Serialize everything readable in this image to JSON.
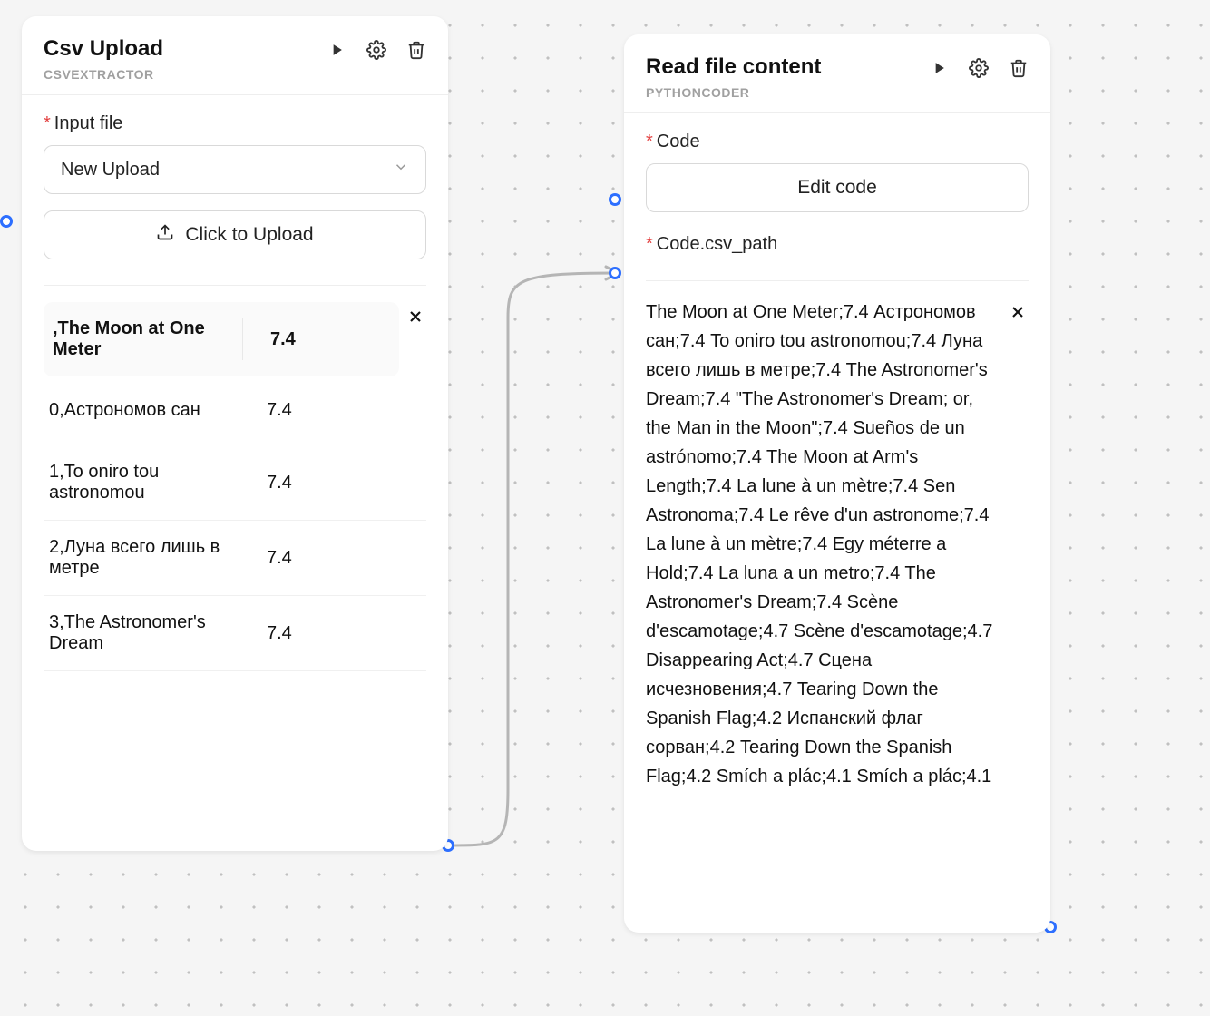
{
  "nodes": {
    "left": {
      "title": "Csv Upload",
      "subtitle": "CSVEXTRACTOR",
      "input_label": "Input file",
      "select_value": "New Upload",
      "upload_button": "Click to Upload",
      "header_col1": ",The Moon at One Meter",
      "header_col2": "7.4",
      "rows": [
        {
          "c1": "0,Астрономов сан",
          "c2": "7.4"
        },
        {
          "c1": "1,To oniro tou astronomou",
          "c2": "7.4"
        },
        {
          "c1": "2,Луна всего лишь в метре",
          "c2": "7.4"
        },
        {
          "c1": "3,The Astronomer's Dream",
          "c2": "7.4"
        }
      ]
    },
    "right": {
      "title": "Read file content",
      "subtitle": "PYTHONCODER",
      "code_label": "Code",
      "edit_button": "Edit code",
      "path_label": "Code.csv_path",
      "output": "The Moon at One Meter;7.4 Астрономов сан;7.4 To oniro tou astronomou;7.4 Луна всего лишь в метре;7.4 The Astronomer's Dream;7.4 \"The Astronomer's Dream; or, the Man in the Moon\";7.4 Sueños de un astrónomo;7.4 The Moon at Arm's Length;7.4 La lune à un mètre;7.4 Sen Astronoma;7.4 Le rêve d'un astronome;7.4 La lune à un mètre;7.4 Egy méterre a Hold;7.4 La luna a un metro;7.4 The Astronomer's Dream;7.4 Scène d'escamotage;4.7 Scène d'escamotage;4.7 Disappearing Act;4.7 Сцена исчезновения;4.7 Tearing Down the Spanish Flag;4.2 Испанский флаг сорван;4.2 Tearing Down the Spanish Flag;4.2 Smích a plác;4.1 Smích a plác;4.1"
    }
  }
}
